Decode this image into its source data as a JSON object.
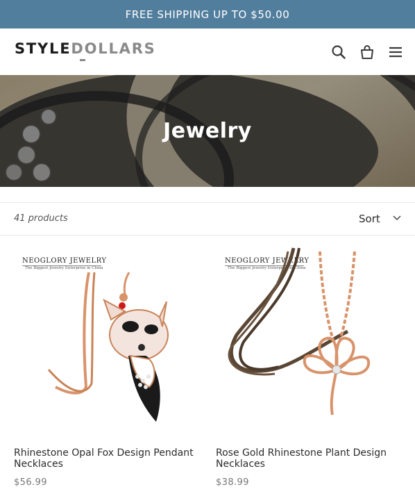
{
  "announcement": {
    "text": "FREE SHIPPING UP TO $50.00"
  },
  "header": {
    "logo_part1": "STYLE",
    "logo_part2": "DOLLARS",
    "icons": [
      "search-icon",
      "cart-icon",
      "menu-icon"
    ]
  },
  "hero": {
    "title": "Jewelry"
  },
  "filter": {
    "count": "41 products",
    "sort_label": "Sort"
  },
  "products": [
    {
      "image_brand": "NEOGLORY JEWELRY",
      "image_tagline": "The Biggest Jewelry Enterprise in China",
      "title": "Rhinestone Opal Fox Design Pendant Necklaces",
      "price": "$56.99"
    },
    {
      "image_brand": "NEOGLORY JEWELRY",
      "image_tagline": "The Biggest Jewelry Enterprise in China",
      "title": "Rose Gold Rhinestone Plant Design Necklaces",
      "price": "$38.99"
    }
  ],
  "colors": {
    "announcement_bg": "#527e9d",
    "rose_gold": "#d9936a",
    "text": "#2c2c2c",
    "price": "#777777"
  }
}
